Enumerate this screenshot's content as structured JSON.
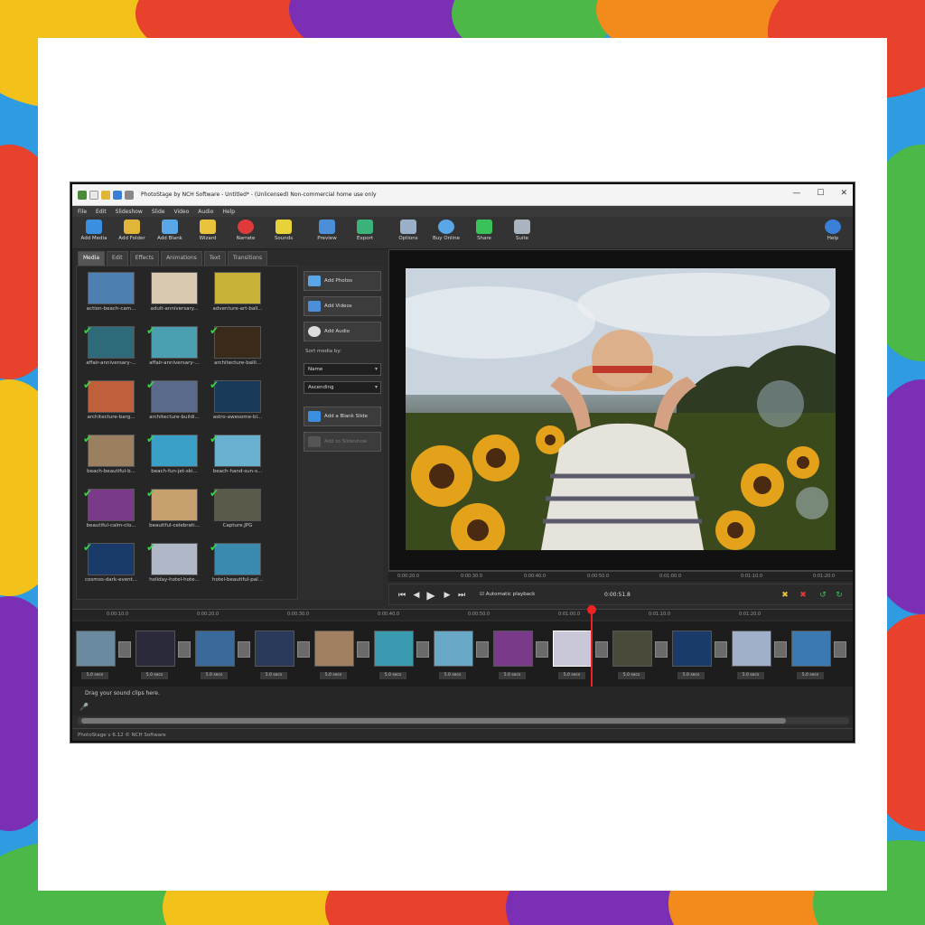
{
  "window": {
    "title": "PhotoStage by NCH Software - Untitled* - (Unlicensed) Non-commercial home use only"
  },
  "menu": [
    "File",
    "Edit",
    "Slideshow",
    "Slide",
    "Video",
    "Audio",
    "Help"
  ],
  "toolbar": [
    {
      "label": "Add Media",
      "icon": "add-media-icon",
      "color": "#3a8fe0"
    },
    {
      "label": "Add Folder",
      "icon": "add-folder-icon",
      "color": "#e0b53a"
    },
    {
      "label": "Add Blank",
      "icon": "add-blank-icon",
      "color": "#5aa7e8"
    },
    {
      "label": "Wizard",
      "icon": "wizard-icon",
      "color": "#e8c23a"
    },
    {
      "label": "Narrate",
      "icon": "narrate-icon",
      "color": "#e03a3a"
    },
    {
      "label": "Sounds",
      "icon": "sounds-icon",
      "color": "#e8d23a"
    },
    {
      "label": "Preview",
      "icon": "preview-icon",
      "color": "#4a8fd8"
    },
    {
      "label": "Export",
      "icon": "export-icon",
      "color": "#3ab27a"
    },
    {
      "label": "Options",
      "icon": "options-icon",
      "color": "#9ab0c8"
    },
    {
      "label": "Buy Online",
      "icon": "buy-online-icon",
      "color": "#5aa7e8"
    },
    {
      "label": "Share",
      "icon": "share-icon",
      "color": "#3ac25a"
    },
    {
      "label": "Suite",
      "icon": "suite-icon",
      "color": "#aab4be"
    },
    {
      "label": "Help",
      "icon": "help-icon",
      "color": "#3a7fd8"
    }
  ],
  "tabs": [
    "Media",
    "Edit",
    "Effects",
    "Animations",
    "Text",
    "Transitions"
  ],
  "media": [
    {
      "caption": "action-beach-cam...",
      "checked": false,
      "color": "#4d7fb0"
    },
    {
      "caption": "adult-anniversary...",
      "checked": false,
      "color": "#d8c9b0"
    },
    {
      "caption": "adventure-art-ball...",
      "checked": false,
      "color": "#c8b23a"
    },
    {
      "caption": "affair-anniversary-...",
      "checked": true,
      "color": "#2f6a7a"
    },
    {
      "caption": "affair-anniversary-...",
      "checked": true,
      "color": "#4aa0b0"
    },
    {
      "caption": "architecture-balli...",
      "checked": true,
      "color": "#3a2a1a"
    },
    {
      "caption": "architecture-barg...",
      "checked": true,
      "color": "#c0603a"
    },
    {
      "caption": "architecture-buildi...",
      "checked": true,
      "color": "#5a6a8a"
    },
    {
      "caption": "astro-awesome-bl...",
      "checked": true,
      "color": "#1a3a5a"
    },
    {
      "caption": "beach-beautiful-b...",
      "checked": true,
      "color": "#9a8060"
    },
    {
      "caption": "beach-fun-jet-ski...",
      "checked": true,
      "color": "#3aa0c8"
    },
    {
      "caption": "beach-hand-sun-s...",
      "checked": true,
      "color": "#6ab0d0"
    },
    {
      "caption": "beautiful-calm-clo...",
      "checked": true,
      "color": "#7a3a8a"
    },
    {
      "caption": "beautiful-celebrati...",
      "checked": true,
      "color": "#c8a070"
    },
    {
      "caption": "Capture.JPG",
      "checked": true,
      "color": "#5a5a4a"
    },
    {
      "caption": "cosmos-dark-event...",
      "checked": true,
      "color": "#1a3a6a"
    },
    {
      "caption": "holiday-hotel-hote...",
      "checked": true,
      "color": "#b0b8c8"
    },
    {
      "caption": "hotel-beautiful-pal...",
      "checked": true,
      "color": "#3a8ab0"
    }
  ],
  "side": {
    "add_photos": "Add Photos",
    "add_videos": "Add Videos",
    "add_audio": "Add Audio",
    "sort_label": "Sort media by:",
    "sort_by": "Name",
    "sort_order": "Ascending",
    "add_blank_slide": "Add a Blank Slide",
    "add_to_slideshow": "Add to Slideshow"
  },
  "preview": {
    "ruler": [
      "0:00:20.0",
      "0:00:30.0",
      "0:00:40.0",
      "0:00:50.0",
      "0:01:00.0",
      "0:01:10.0",
      "0:01:20.0"
    ],
    "auto_playback": "Automatic playback",
    "timecode": "0:00:51.8"
  },
  "timeline": {
    "ruler": [
      "0:00:10.0",
      "0:00:20.0",
      "0:00:30.0",
      "0:00:40.0",
      "0:00:50.0",
      "0:01:00.0",
      "0:01:10.0",
      "0:01:20.0"
    ],
    "slide_colors": [
      "#6a8aa0",
      "#2a2a3a",
      "#3a6a9a",
      "#2a3a5a",
      "#a08060",
      "#3a9ab0",
      "#6aa8c8",
      "#7a3a8a",
      "#c8c8d8",
      "#4a4a3a",
      "#1a3a6a",
      "#a0b0c8",
      "#3a7ab0"
    ],
    "duration": "5.0 secs",
    "drag_sound": "Drag your sound clips here."
  },
  "status": "PhotoStage v 6.12 © NCH Software"
}
